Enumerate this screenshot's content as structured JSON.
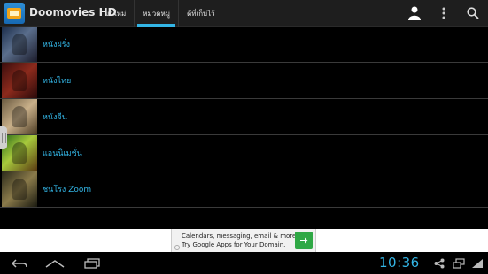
{
  "app": {
    "title": "Doomovies HD"
  },
  "tabs": [
    {
      "label": "มาใหม่",
      "active": false
    },
    {
      "label": "หมวดหมู่",
      "active": true
    },
    {
      "label": "ดีที่เก็บไว้",
      "active": false
    }
  ],
  "actionbar_icons": [
    "account-icon",
    "overflow-menu-icon",
    "search-icon"
  ],
  "categories": [
    {
      "label": "หนังฝรั่ง"
    },
    {
      "label": "หนังไทย"
    },
    {
      "label": "หนังจีน"
    },
    {
      "label": "แอนนิเมชั่น"
    },
    {
      "label": "ชนโรง Zoom"
    }
  ],
  "ad": {
    "line1": "Calendars, messaging, email & more.",
    "line2": "Try Google Apps for Your Domain."
  },
  "system_bar": {
    "clock": "10:36"
  },
  "colors": {
    "accent": "#33b5e5",
    "ad_button": "#2fa845",
    "background": "#000000",
    "actionbar": "#1e1e1e"
  }
}
